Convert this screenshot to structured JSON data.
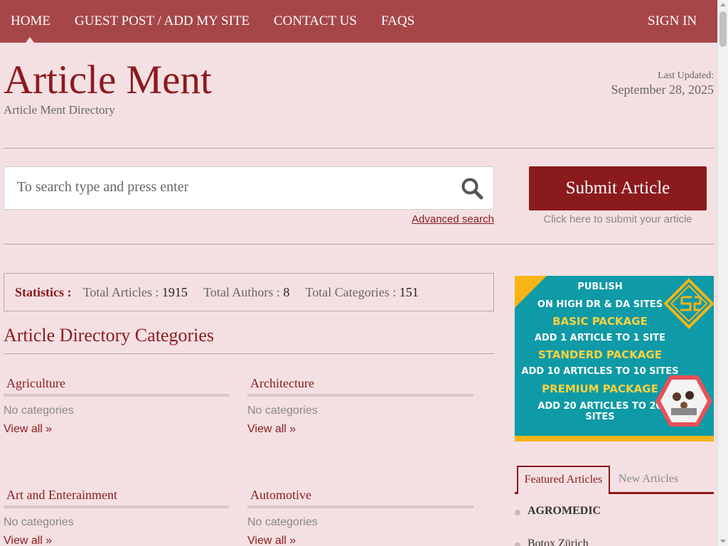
{
  "nav": {
    "items": [
      "HOME",
      "GUEST POST / ADD MY SITE",
      "CONTACT US",
      "FAQS"
    ],
    "signin": "SIGN IN"
  },
  "header": {
    "title": "Article Ment",
    "tagline": "Article Ment Directory",
    "updated_label": "Last Updated:",
    "updated_date": "September 28, 2025"
  },
  "search": {
    "placeholder": "To search type and press enter",
    "advanced_label": "Advanced search"
  },
  "submit": {
    "button_label": "Submit Article",
    "subtext": "Click here to submit your article"
  },
  "stats": {
    "heading": "Statistics :",
    "articles_label": "Total Articles :",
    "articles_value": "1915",
    "authors_label": "Total Authors :",
    "authors_value": "8",
    "categories_label": "Total Categories :",
    "categories_value": "151"
  },
  "categories": {
    "section_title": "Article Directory Categories",
    "items": [
      {
        "title": "Agriculture",
        "empty_text": "No categories",
        "view_all": "View all »"
      },
      {
        "title": "Architecture",
        "empty_text": "No categories",
        "view_all": "View all »"
      },
      {
        "title": "Art and Enterainment",
        "empty_text": "No categories",
        "view_all": "View all »"
      },
      {
        "title": "Automotive",
        "empty_text": "No categories",
        "view_all": "View all »"
      }
    ]
  },
  "ad": {
    "lines": [
      "PUBLISH",
      "ON HIGH DR & DA SITES",
      "BASIC PACKAGE",
      "ADD 1 ARTICLE TO 1 SITE",
      "STANDERD PACKAGE",
      "ADD 10 ARTICLES TO 10 SITES",
      "PREMIUM PACKAGE",
      "ADD 20 ARTICLES TO 20",
      "SITES"
    ],
    "background_color": "#0e9aa6",
    "accent_color": "#f6b416"
  },
  "sidebar_tabs": {
    "active": "Featured Articles",
    "inactive": "New Articles"
  },
  "featured": {
    "items": [
      "AGROMEDIC",
      "Botox Zürich"
    ]
  },
  "colors": {
    "brand": "#8b1a1d",
    "nav_bg": "#a64649",
    "page_bg": "#f4e0e2"
  }
}
